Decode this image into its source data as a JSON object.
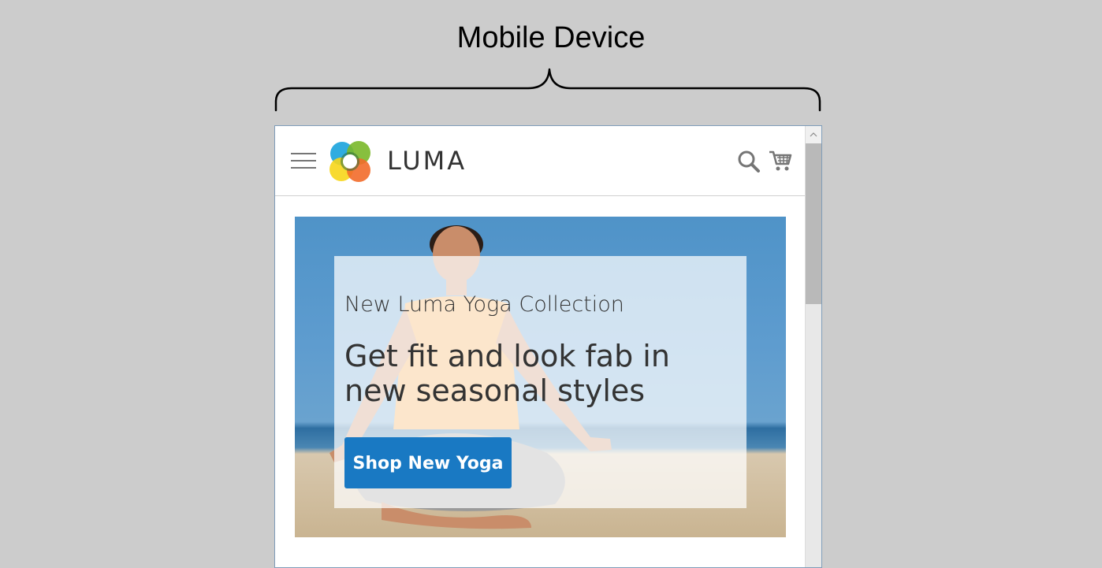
{
  "annotation": {
    "title": "Mobile Device"
  },
  "header": {
    "menu_icon": "hamburger-menu-icon",
    "logo_icon": "luma-logo-icon",
    "logo_text": "LUMA",
    "search_icon": "search-icon",
    "cart_icon": "shopping-cart-icon"
  },
  "hero": {
    "kicker": "New Luma Yoga Collection",
    "headline": "Get fit and look fab in new seasonal styles",
    "button_label": "Shop New Yoga"
  },
  "colors": {
    "background": "#cccccc",
    "accent": "#1979c3",
    "text": "#333333",
    "icon": "#757575"
  }
}
